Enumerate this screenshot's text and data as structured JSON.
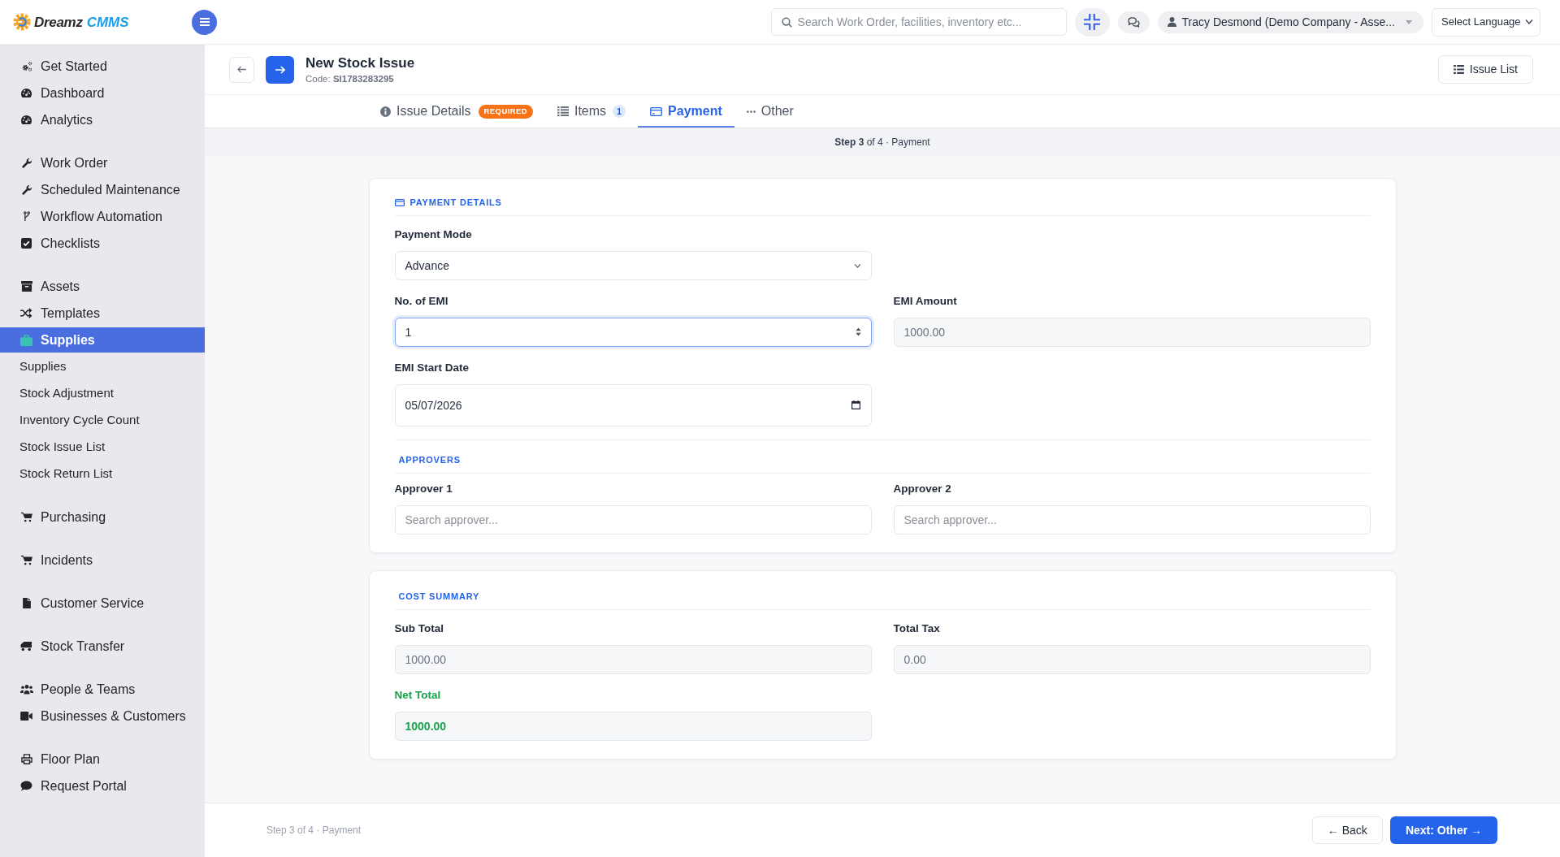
{
  "topbar": {
    "logo": {
      "text": "Dreamz",
      "accent": "CMMS"
    },
    "search": {
      "placeholder": "Search Work Order, facilities, inventory etc..."
    },
    "user": "Tracy Desmond (Demo Company - Asse...",
    "language": "Select Language"
  },
  "sidebar": {
    "groups": [
      {
        "items": [
          {
            "label": "Get Started",
            "selected": false
          },
          {
            "label": "Dashboard",
            "selected": false
          },
          {
            "label": "Analytics",
            "selected": false
          }
        ]
      },
      {
        "items": [
          {
            "label": "Work Order",
            "selected": false
          },
          {
            "label": "Scheduled Maintenance",
            "selected": false
          },
          {
            "label": "Workflow Automation",
            "selected": false
          },
          {
            "label": "Checklists",
            "selected": false
          }
        ]
      },
      {
        "items": [
          {
            "label": "Assets",
            "selected": false
          },
          {
            "label": "Templates",
            "selected": false
          },
          {
            "label": "Supplies",
            "selected": true,
            "children": [
              {
                "label": "Supplies",
                "selected": false
              },
              {
                "label": "Stock Adjustment",
                "selected": false
              },
              {
                "label": "Inventory Cycle Count",
                "selected": false
              },
              {
                "label": "Stock Issue List",
                "selected": false
              },
              {
                "label": "Stock Return List",
                "selected": false
              }
            ]
          }
        ]
      },
      {
        "items": [
          {
            "label": "Purchasing",
            "selected": false
          }
        ]
      },
      {
        "items": [
          {
            "label": "Incidents",
            "selected": false
          }
        ]
      },
      {
        "items": [
          {
            "label": "Customer Service",
            "selected": false
          }
        ]
      },
      {
        "items": [
          {
            "label": "Stock Transfer",
            "selected": false
          }
        ]
      },
      {
        "items": [
          {
            "label": "People & Teams",
            "selected": false
          },
          {
            "label": "Businesses & Customers",
            "selected": false
          }
        ]
      },
      {
        "items": [
          {
            "label": "Floor Plan",
            "selected": false
          },
          {
            "label": "Request Portal",
            "selected": false
          }
        ]
      }
    ]
  },
  "header": {
    "title": "New Stock Issue",
    "code": "Code: **SI1783283295**",
    "action": "Issue List"
  },
  "tabs": [
    {
      "label": "Issue Details",
      "badge": "REQUIRED",
      "selected": false
    },
    {
      "label": "Items",
      "count": "1",
      "selected": false
    },
    {
      "label": "Payment",
      "selected": true
    },
    {
      "label": "Other",
      "selected": false
    }
  ],
  "step": "**Step 3** of 4 · Payment",
  "cards": [
    {
      "sections": [
        {
          "title": "PAYMENT DETAILS",
          "rows": [
            [
              {
                "kind": "select",
                "label": "Payment Mode",
                "value": "Advance",
                "focused": false
              }
            ],
            [
              {
                "kind": "number",
                "label": "No. of EMI",
                "value": "1",
                "focused": true
              },
              {
                "kind": "readonly",
                "label": "EMI Amount",
                "value": "1000.00",
                "focused": false
              }
            ],
            [
              {
                "kind": "date",
                "label": "EMI Start Date",
                "value": "05/07/2026",
                "focused": false
              }
            ]
          ]
        },
        {
          "title": "APPROVERS",
          "rows": [
            [
              {
                "kind": "search",
                "label": "Approver 1",
                "placeholder": "Search approver...",
                "focused": false
              },
              {
                "kind": "search",
                "label": "Approver 2",
                "placeholder": "Search approver...",
                "focused": false
              }
            ]
          ]
        }
      ]
    },
    {
      "sections": [
        {
          "title": "COST SUMMARY",
          "rows": [
            [
              {
                "kind": "readonly",
                "label": "Sub Total",
                "value": "1000.00",
                "focused": false
              },
              {
                "kind": "readonly",
                "label": "Total Tax",
                "value": "0.00",
                "focused": false
              }
            ],
            [
              {
                "kind": "total",
                "label": "Net Total",
                "value": "1000.00",
                "focused": false
              }
            ]
          ]
        }
      ]
    }
  ],
  "footer": {
    "step": "Step 3 of 4 · Payment",
    "buttons": [
      {
        "kind": "back",
        "label": "← Back"
      },
      {
        "kind": "next",
        "label": "Next: Other →"
      }
    ]
  }
}
